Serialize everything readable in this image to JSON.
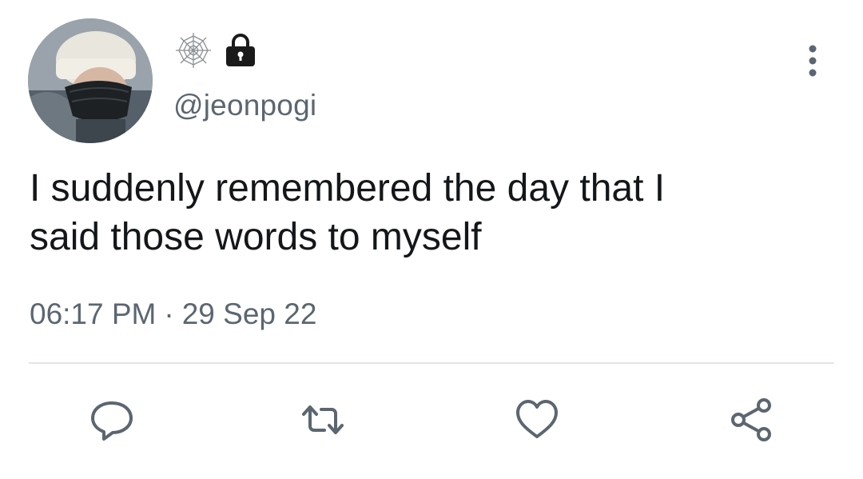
{
  "tweet": {
    "handle": "@jeonpogi",
    "text": "I suddenly remembered the day that I\nsaid those words to myself",
    "time": "06:17 PM",
    "separator": "·",
    "date": "29 Sep 22"
  },
  "icons": {
    "name_area": [
      "spider-web-icon",
      "lock-icon"
    ],
    "menu": "more-vertical-icon",
    "actions": [
      "reply-icon",
      "retweet-icon",
      "like-icon",
      "share-icon"
    ]
  },
  "colors": {
    "text": "#14171a",
    "secondary": "#5b6670",
    "divider": "#e3e6e9",
    "icon": "#5b6670"
  }
}
